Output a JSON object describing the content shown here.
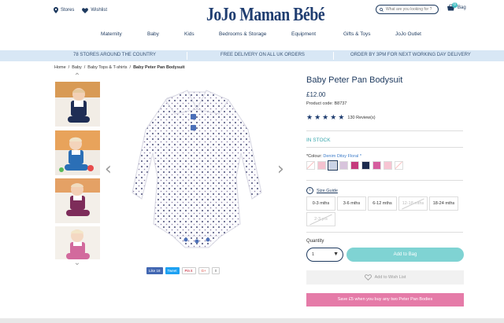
{
  "header": {
    "stores_label": "Stores",
    "wishlist_label": "Wishlist",
    "logo": "JoJo Maman Bébé",
    "search_placeholder": "What are you looking for ?",
    "bag_label": "Bag",
    "bag_count": "0"
  },
  "nav": {
    "items": [
      "Maternity",
      "Baby",
      "Kids",
      "Bedrooms & Storage",
      "Equipment",
      "Gifts & Toys",
      "JoJo Outlet"
    ]
  },
  "promo": {
    "left": "78 STORES AROUND THE COUNTRY",
    "center": "FREE DELIVERY ON ALL UK ORDERS",
    "right": "ORDER BY 3PM FOR NEXT WORKING DAY DELIVERY"
  },
  "breadcrumb": {
    "items": [
      "Home",
      "Baby",
      "Baby Tops & T-shirts"
    ],
    "separator": "/",
    "current": "Baby Peter Pan Bodysuit"
  },
  "product": {
    "title": "Baby Peter Pan Bodysuit",
    "price": "£12.00",
    "code": "Product code: B8737",
    "rating": 5,
    "reviews": "130 Review(s)",
    "stock": "IN STOCK",
    "colour_label": "*Colour:",
    "colour_value": "Denim Ditsy Floral *",
    "swatches": [
      "#ffffff",
      "#f4c2cf",
      "#c9d3e6",
      "#d8c4dc",
      "#c53a7c",
      "#1c2a4d",
      "#d65d9e",
      "#f7c5d3",
      "#ffffff"
    ],
    "size_guide": "Size Guide",
    "sizes": [
      {
        "label": "0-3 mths",
        "disabled": false
      },
      {
        "label": "3-6 mths",
        "disabled": false
      },
      {
        "label": "6-12 mths",
        "disabled": false
      },
      {
        "label": "12-18 mths",
        "disabled": true
      },
      {
        "label": "18-24 mths",
        "disabled": false
      },
      {
        "label": "2-3 yrs",
        "disabled": true
      }
    ],
    "quantity_label": "Quantity",
    "quantity_value": "1",
    "add_to_bag": "Add to Bag",
    "wishlist": "Add to Wish List",
    "offer": "Save £5 when you buy any two Peter Pan Bodies"
  },
  "social": {
    "like": "Like 18",
    "tweet": "Tweet",
    "pin": "Pin it",
    "gplus": "G+",
    "gcount": "0"
  },
  "colors": {
    "brand_navy": "#1f3d70",
    "accent_teal": "#7fd3d3",
    "promo_pink": "#e57ba8",
    "promo_bar": "#d8e7f5"
  }
}
